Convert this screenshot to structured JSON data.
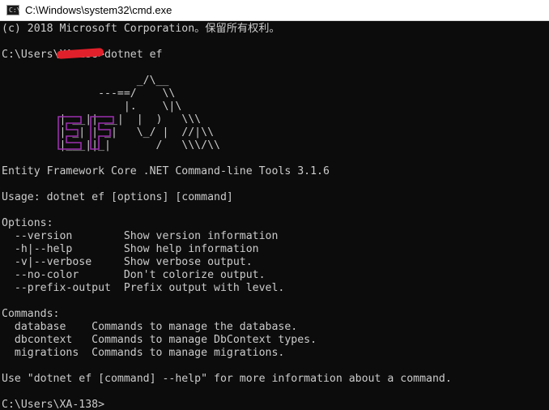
{
  "window": {
    "title": "C:\\Windows\\system32\\cmd.exe",
    "icon": "cmd-icon",
    "icon_text": "C:\\"
  },
  "console": {
    "lines": [
      "(c) 2018 Microsoft Corporation。保留所有权利。",
      "",
      "C:\\Users\\XA-138>dotnet ef",
      "",
      "                     _/\\__",
      "               ---==/    \\\\",
      "                   |.    \\|\\",
      "         | __|| __|  |  )   \\\\\\",
      "         | _| | _|   \\_/ |  //|\\\\",
      "         |___||_|       /   \\\\\\/\\\\",
      "",
      "Entity Framework Core .NET Command-line Tools 3.1.6",
      "",
      "Usage: dotnet ef [options] [command]",
      "",
      "Options:",
      "  --version        Show version information",
      "  -h|--help        Show help information",
      "  -v|--verbose     Show verbose output.",
      "  --no-color       Don't colorize output.",
      "  --prefix-output  Prefix output with level.",
      "",
      "Commands:",
      "  database    Commands to manage the database.",
      "  dbcontext   Commands to manage DbContext types.",
      "  migrations  Commands to manage migrations.",
      "",
      "Use \"dotnet ef [command] --help\" for more information about a command.",
      "",
      "C:\\Users\\XA-138>"
    ],
    "prompt_redaction_color": "#e0202a",
    "logo_color": "#9b2fae"
  }
}
